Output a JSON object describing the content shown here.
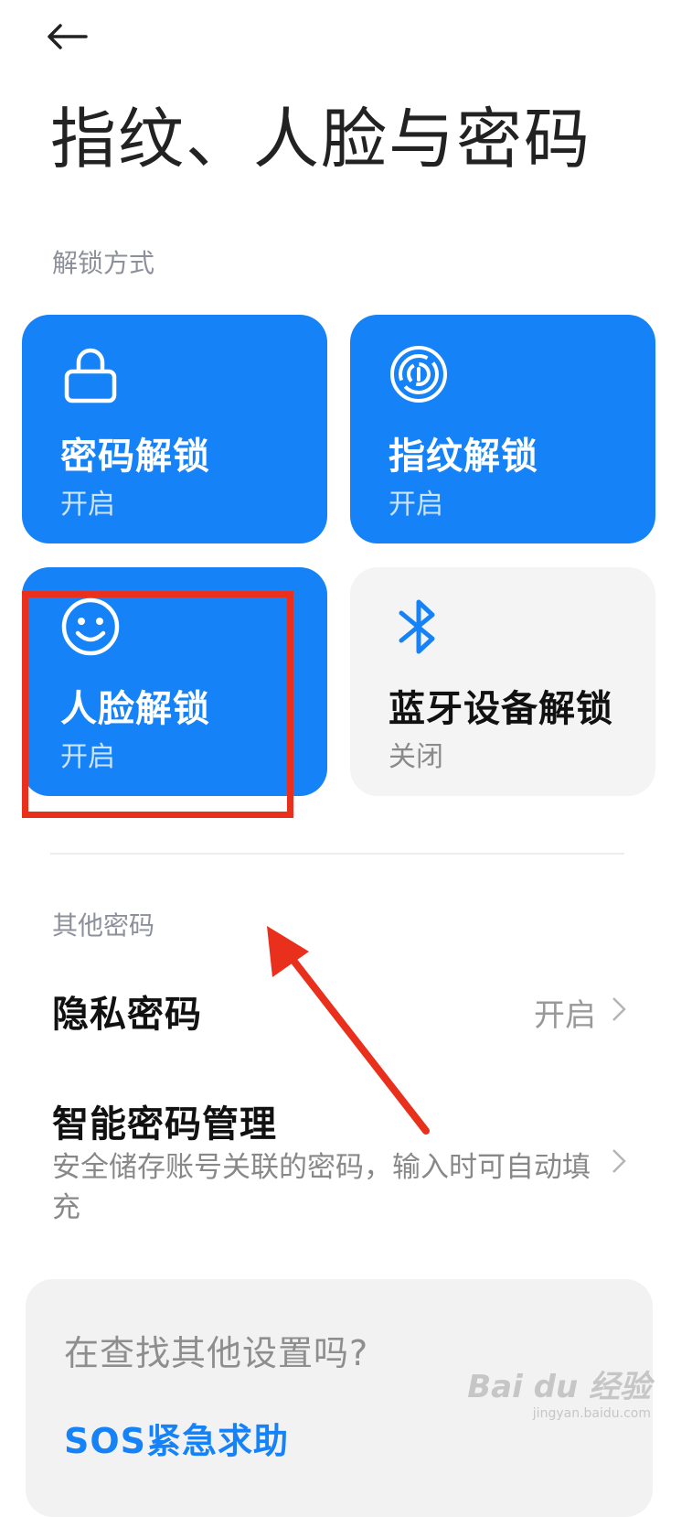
{
  "header": {
    "back_icon": "arrow-left-icon",
    "title": "指纹、人脸与密码"
  },
  "unlock_section": {
    "label": "解锁方式",
    "tiles": [
      {
        "icon": "lock-icon",
        "title": "密码解锁",
        "status": "开启",
        "active": true
      },
      {
        "icon": "fingerprint-icon",
        "title": "指纹解锁",
        "status": "开启",
        "active": true
      },
      {
        "icon": "face-icon",
        "title": "人脸解锁",
        "status": "开启",
        "active": true
      },
      {
        "icon": "bluetooth-icon",
        "title": "蓝牙设备解锁",
        "status": "关闭",
        "active": false
      }
    ]
  },
  "other_section": {
    "label": "其他密码",
    "privacy": {
      "title": "隐私密码",
      "status": "开启"
    },
    "smart": {
      "title": "智能密码管理",
      "desc": "安全储存账号关联的密码，输入时可自动填充"
    }
  },
  "search_card": {
    "question": "在查找其他设置吗?",
    "link": "SOS紧急求助"
  },
  "watermark": {
    "main": "Bai du 经验",
    "sub": "jingyan.baidu.com"
  },
  "colors": {
    "accent": "#1583f7",
    "annotation": "#e8301c",
    "tile_off": "#f4f4f4"
  }
}
